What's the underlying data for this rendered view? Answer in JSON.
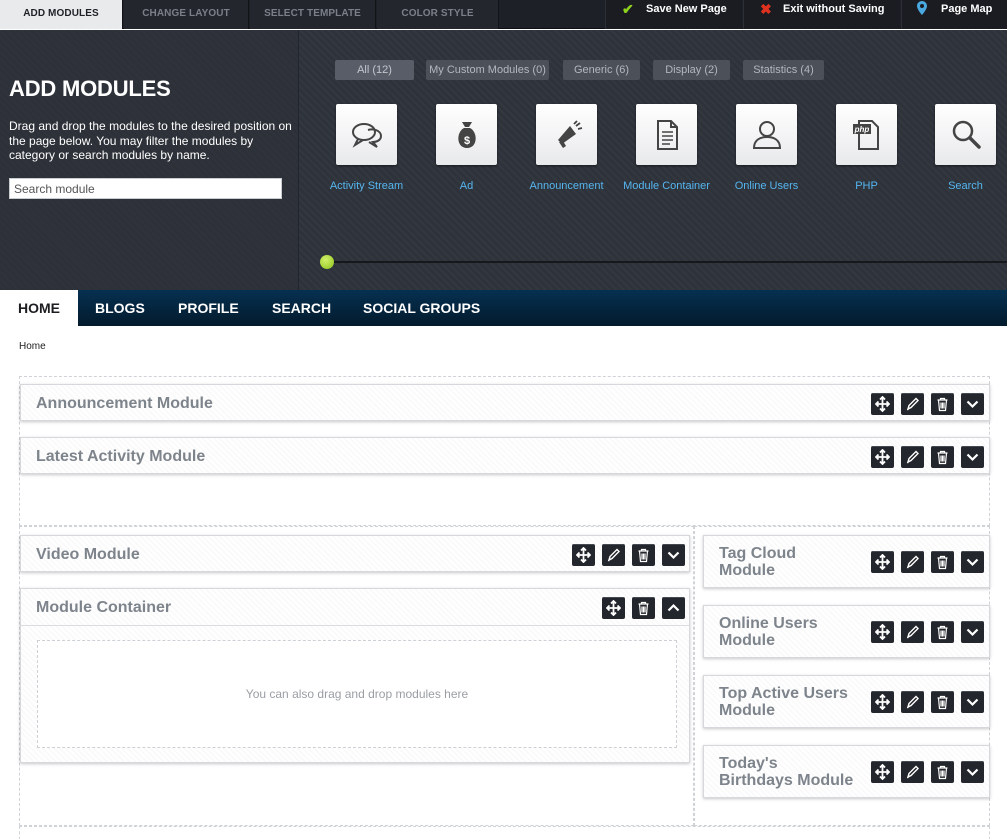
{
  "top_tabs": [
    "ADD MODULES",
    "CHANGE LAYOUT",
    "SELECT TEMPLATE",
    "COLOR STYLE"
  ],
  "actions": {
    "save": "Save New Page",
    "exit": "Exit without Saving",
    "page_map": "Page Map"
  },
  "panel": {
    "title": "ADD MODULES",
    "description": "Drag and drop the modules to the desired position on the page below. You may filter the modules by category or search modules by name.",
    "search_placeholder": "Search module"
  },
  "filters": [
    "All (12)",
    "My Custom Modules (0)",
    "Generic (6)",
    "Display (2)",
    "Statistics (4)"
  ],
  "modules": [
    {
      "label": "Activity Stream",
      "icon": "chat-bubbles-icon"
    },
    {
      "label": "Ad",
      "icon": "money-bag-icon"
    },
    {
      "label": "Announcement",
      "icon": "megaphone-icon"
    },
    {
      "label": "Module Container",
      "icon": "document-icon"
    },
    {
      "label": "Online Users",
      "icon": "user-icon"
    },
    {
      "label": "PHP",
      "icon": "php-file-icon"
    },
    {
      "label": "Search",
      "icon": "magnifier-icon"
    }
  ],
  "nav": [
    "HOME",
    "BLOGS",
    "PROFILE",
    "SEARCH",
    "SOCIAL GROUPS"
  ],
  "breadcrumb": "Home",
  "layout": {
    "full_width": [
      "Announcement Module",
      "Latest Activity Module"
    ],
    "main": [
      "Video Module",
      "Module Container"
    ],
    "sidebar": [
      "Tag Cloud Module",
      "Online Users Module",
      "Top Active Users Module",
      "Today's Birthdays Module"
    ],
    "dropzone_text": "You can also drag and drop modules here"
  },
  "sidebar_title_lines": [
    [
      "Tag Cloud",
      "Module"
    ],
    [
      "Online Users",
      "Module"
    ],
    [
      "Top Active Users",
      "Module"
    ],
    [
      "Today's",
      "Birthdays Module"
    ]
  ],
  "colors": {
    "accent": "#8fd11f",
    "link": "#55b6f0",
    "panel_bg": "#2e323a",
    "nav_bg": "#05233a"
  }
}
